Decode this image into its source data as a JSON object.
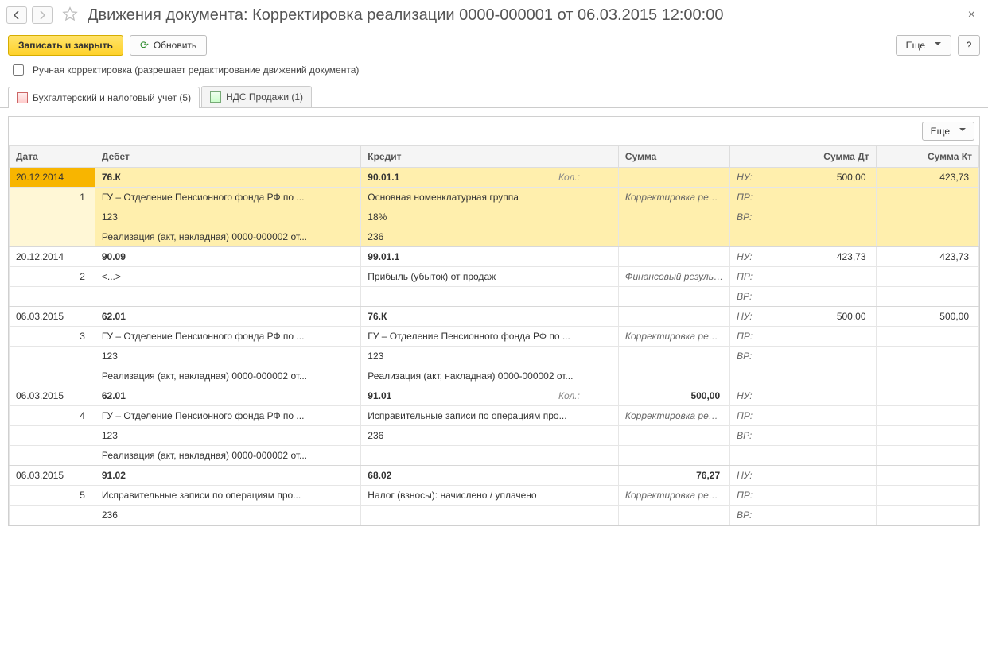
{
  "header": {
    "title": "Движения документа: Корректировка реализации 0000-000001 от 06.03.2015 12:00:00"
  },
  "toolbar": {
    "save_close": "Записать и закрыть",
    "refresh": "Обновить",
    "more": "Еще",
    "help": "?"
  },
  "manual_edit": {
    "checked": false,
    "label": "Ручная корректировка (разрешает редактирование движений документа)"
  },
  "tabs": {
    "accounting": "Бухгалтерский и налоговый учет (5)",
    "vat": "НДС Продажи (1)"
  },
  "grid": {
    "more": "Еще",
    "columns": {
      "date": "Дата",
      "debit": "Дебет",
      "credit": "Кредит",
      "sum": "Сумма",
      "sum_dt": "Сумма Дт",
      "sum_kt": "Сумма Кт"
    },
    "tags": {
      "nu": "НУ:",
      "pr": "ПР:",
      "vr": "ВР:"
    },
    "kol": "Кол.:",
    "rows": [
      {
        "n": "1",
        "date": "20.12.2014",
        "deb_acc": "76.К",
        "deb_l1": "ГУ – Отделение Пенсионного фонда РФ по ...",
        "deb_l2": "123",
        "deb_l3": "Реализация (акт, накладная) 0000-000002 от...",
        "cred_acc": "90.01.1",
        "cred_has_kol": true,
        "cred_l1": "Основная номенклатурная группа",
        "cred_l2": "18%",
        "cred_l3": "236",
        "sum": "",
        "sum_desc": "Корректировка реализации",
        "nu_dt": "500,00",
        "nu_kt": "423,73",
        "selected": true,
        "lines": 4
      },
      {
        "n": "2",
        "date": "20.12.2014",
        "deb_acc": "90.09",
        "deb_l1": "<...>",
        "cred_acc": "99.01.1",
        "cred_l1": "Прибыль (убыток) от продаж",
        "sum": "",
        "sum_desc": "Финансовый результат ...",
        "nu_dt": "423,73",
        "nu_kt": "423,73",
        "lines": 3
      },
      {
        "n": "3",
        "date": "06.03.2015",
        "deb_acc": "62.01",
        "deb_l1": "ГУ – Отделение Пенсионного фонда РФ по ...",
        "deb_l2": "123",
        "deb_l3": "Реализация (акт, накладная) 0000-000002 от...",
        "cred_acc": "76.К",
        "cred_l1": "ГУ – Отделение Пенсионного фонда РФ по ...",
        "cred_l2": "123",
        "cred_l3": "Реализация (акт, накладная) 0000-000002 от...",
        "sum": "",
        "sum_desc": "Корректировка реализации",
        "nu_dt": "500,00",
        "nu_kt": "500,00",
        "lines": 4
      },
      {
        "n": "4",
        "date": "06.03.2015",
        "deb_acc": "62.01",
        "deb_l1": "ГУ – Отделение Пенсионного фонда РФ по ...",
        "deb_l2": "123",
        "deb_l3": "Реализация (акт, накладная) 0000-000002 от...",
        "cred_acc": "91.01",
        "cred_has_kol": true,
        "cred_l1": "Исправительные записи по операциям про...",
        "cred_l2": "236",
        "sum": "500,00",
        "sum_desc": "Корректировка реализации",
        "nu_dt": "",
        "nu_kt": "",
        "lines": 4
      },
      {
        "n": "5",
        "date": "06.03.2015",
        "deb_acc": "91.02",
        "deb_l1": "Исправительные записи по операциям про...",
        "deb_l2": "236",
        "cred_acc": "68.02",
        "cred_l1": "Налог (взносы): начислено / уплачено",
        "sum": "76,27",
        "sum_desc": "Корректировка реализации",
        "nu_dt": "",
        "nu_kt": "",
        "lines": 3
      }
    ]
  }
}
